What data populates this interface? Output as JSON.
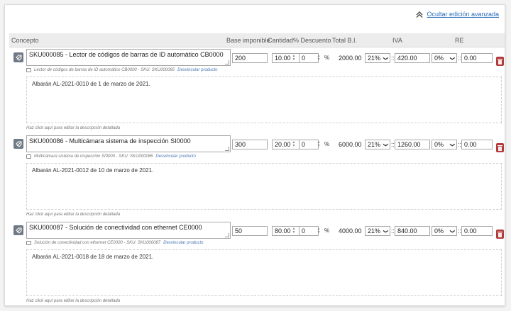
{
  "toggle_link": "Ocultar edición avanzada",
  "columns": {
    "concepto": "Concepto",
    "base_imponible": "Base imponible",
    "cantidad": "Cantidad",
    "descuento": "% Descuento",
    "total_bi": "Total B.I.",
    "iva": "IVA",
    "re": "RE"
  },
  "percent_sign": "%",
  "separator": "::",
  "description_hint": "Haz click aquí para editar la descripción detallada",
  "unlink_label": "Desvincular producto",
  "lines": [
    {
      "concept": "SKU000085 - Lector de códigos de barras de ID automático CB0000",
      "sku_info": "Lector de códigos de barras de ID automático CB0000 - SKU: SKU000085",
      "base": "200",
      "quantity": "10.00",
      "discount": "0",
      "total": "2000.00",
      "iva_rate": "21%",
      "iva_amount": "420.00",
      "re_rate": "0%",
      "re_amount": "0.00",
      "description": "Albarán AL-2021-0010 de 1 de marzo de 2021."
    },
    {
      "concept": "SKU000086 - Multicámara sistema de inspección SI0000",
      "sku_info": "Multicámara sistema de inspección SI0000 - SKU: SKU000086",
      "base": "300",
      "quantity": "20.00",
      "discount": "0",
      "total": "6000.00",
      "iva_rate": "21%",
      "iva_amount": "1260.00",
      "re_rate": "0%",
      "re_amount": "0.00",
      "description": "Albarán AL-2021-0012 de 10 de marzo de 2021."
    },
    {
      "concept": "SKU000087 - Solución de conectividad con ethernet CE0000",
      "sku_info": "Solución de conectividad con ethernet CE0000 - SKU: SKU000087",
      "base": "50",
      "quantity": "80.00",
      "discount": "0",
      "total": "4000.00",
      "iva_rate": "21%",
      "iva_amount": "840.00",
      "re_rate": "0%",
      "re_amount": "0.00",
      "description": "Albarán AL-2021-0018 de 18 de marzo de 2021."
    }
  ]
}
